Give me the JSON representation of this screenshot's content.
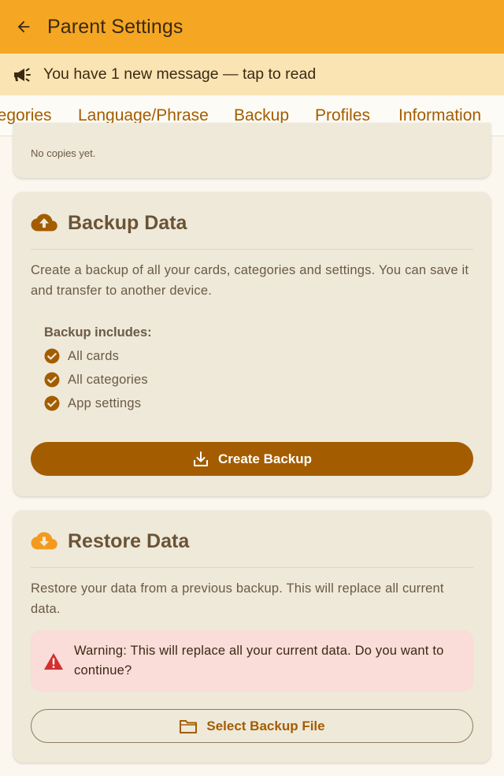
{
  "appbar": {
    "title": "Parent Settings"
  },
  "banner": {
    "text": "You have 1 new message — tap to read"
  },
  "tabs": [
    {
      "label": "Categories"
    },
    {
      "label": "Language/Phrase"
    },
    {
      "label": "Backup",
      "active": true
    },
    {
      "label": "Profiles"
    },
    {
      "label": "Information"
    }
  ],
  "copies": {
    "empty_text": "No copies yet."
  },
  "backup": {
    "title": "Backup Data",
    "description": "Create a backup of all your cards, categories and settings. You can save it and transfer to another device.",
    "includes_title": "Backup includes:",
    "includes": [
      "All cards",
      "All categories",
      "App settings"
    ],
    "button_label": "Create Backup"
  },
  "restore": {
    "title": "Restore Data",
    "description": "Restore your data from a previous backup. This will replace all current data.",
    "warning": "Warning: This will replace all your current data. Do you want to continue?",
    "button_label": "Select Backup File"
  },
  "colors": {
    "appbar": "#f5a623",
    "banner": "#fbe4b3",
    "accent": "#a35d00",
    "card": "#efe9da",
    "warning_bg": "#fadcd9",
    "warning_icon": "#d32f2f"
  },
  "icons": {
    "back": "arrow-left-icon",
    "banner": "megaphone-icon",
    "backup": "cloud-upload-icon",
    "restore": "cloud-download-icon",
    "include": "check-circle-icon",
    "create": "download-icon",
    "warning": "warning-triangle-icon",
    "select": "folder-icon"
  }
}
